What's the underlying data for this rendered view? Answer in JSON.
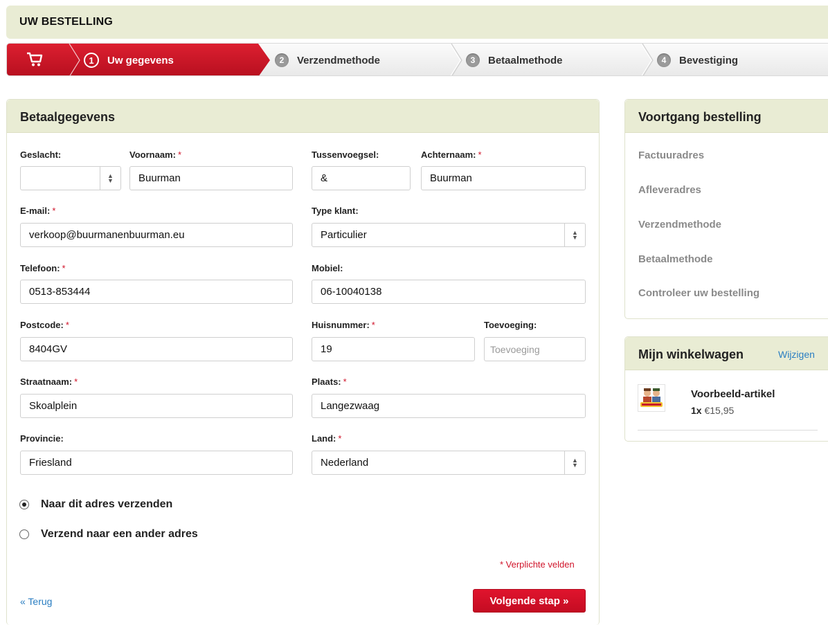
{
  "header": {
    "title": "UW BESTELLING"
  },
  "steps": [
    {
      "num": "1",
      "label": "Uw gegevens"
    },
    {
      "num": "2",
      "label": "Verzendmethode"
    },
    {
      "num": "3",
      "label": "Betaalmethode"
    },
    {
      "num": "4",
      "label": "Bevestiging"
    }
  ],
  "form": {
    "title": "Betaalgegevens",
    "required_mark": "*",
    "fields": {
      "gender": {
        "label": "Geslacht:",
        "value": ""
      },
      "firstname": {
        "label": "Voornaam:",
        "value": "Buurman"
      },
      "infix": {
        "label": "Tussenvoegsel:",
        "value": "&"
      },
      "lastname": {
        "label": "Achternaam:",
        "value": "Buurman"
      },
      "email": {
        "label": "E-mail:",
        "value": "verkoop@buurmanenbuurman.eu"
      },
      "customer_type": {
        "label": "Type klant:",
        "value": "Particulier"
      },
      "phone": {
        "label": "Telefoon:",
        "value": "0513-853444"
      },
      "mobile": {
        "label": "Mobiel:",
        "value": "06-10040138"
      },
      "postcode": {
        "label": "Postcode:",
        "value": "8404GV"
      },
      "housenumber": {
        "label": "Huisnummer:",
        "value": "19"
      },
      "addition": {
        "label": "Toevoeging:",
        "value": "",
        "placeholder": "Toevoeging"
      },
      "street": {
        "label": "Straatnaam:",
        "value": "Skoalplein"
      },
      "city": {
        "label": "Plaats:",
        "value": "Langezwaag"
      },
      "province": {
        "label": "Provincie:",
        "value": "Friesland"
      },
      "country": {
        "label": "Land:",
        "value": "Nederland"
      }
    },
    "shipping_options": [
      {
        "label": "Naar dit adres verzenden",
        "checked": true
      },
      {
        "label": "Verzend naar een ander adres",
        "checked": false
      }
    ],
    "required_note": "* Verplichte velden",
    "back_label": "« Terug",
    "next_label": "Volgende stap »"
  },
  "progress": {
    "title": "Voortgang bestelling",
    "items": [
      "Factuuradres",
      "Afleveradres",
      "Verzendmethode",
      "Betaalmethode",
      "Controleer uw bestelling"
    ]
  },
  "cart": {
    "title": "Mijn winkelwagen",
    "edit_label": "Wijzigen",
    "product": {
      "name": "Voorbeeld-artikel",
      "qty": "1x",
      "price": "€15,95"
    }
  },
  "colors": {
    "accent": "#c8142a",
    "header_bg": "#e9ecd4",
    "link": "#2a7ec2"
  }
}
